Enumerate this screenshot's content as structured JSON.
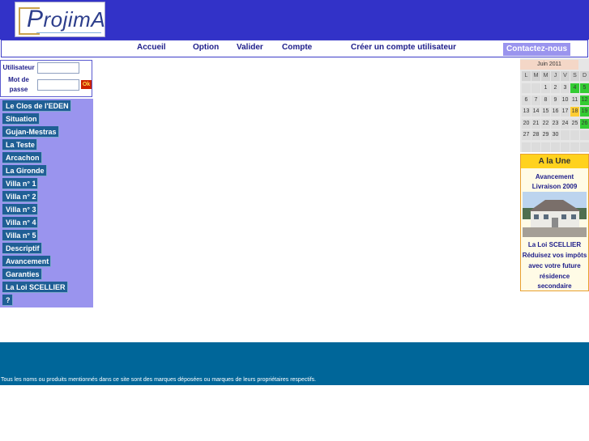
{
  "logo": {
    "wordmark": "rojimA",
    "initial": "P"
  },
  "nav": {
    "items": [
      "Accueil",
      "Option",
      "Valider",
      "Compte",
      "Créer un compte utilisateur"
    ],
    "contact": "Contactez-nous"
  },
  "login": {
    "user_label": "Utilisateur",
    "pass_label_1": "Mot de",
    "pass_label_2": "passe",
    "user_value": "",
    "pass_value": "",
    "ok_label": "Ok"
  },
  "sidemenu": {
    "items": [
      "Le Clos de l'EDEN",
      "Situation",
      "Gujan-Mestras",
      "La Teste",
      "Arcachon",
      "La Gironde",
      "Villa n° 1",
      "Villa n° 2",
      "Villa n° 3",
      "Villa n° 4",
      "Villa n° 5",
      "Descriptif",
      "Avancement",
      "Garanties",
      "La Loi SCELLIER",
      "?"
    ]
  },
  "calendar": {
    "title": "Juin 2011",
    "weekdays": [
      "L",
      "M",
      "M",
      "J",
      "V",
      "S",
      "D"
    ],
    "weeks": [
      [
        "",
        "",
        "1",
        "2",
        "3",
        "4",
        "5"
      ],
      [
        "6",
        "7",
        "8",
        "9",
        "10",
        "11",
        "12"
      ],
      [
        "13",
        "14",
        "15",
        "16",
        "17",
        "18",
        "19"
      ],
      [
        "20",
        "21",
        "22",
        "23",
        "24",
        "25",
        "26"
      ],
      [
        "27",
        "28",
        "29",
        "30",
        "",
        "",
        ""
      ],
      [
        "",
        "",
        "",
        "",
        "",
        "",
        ""
      ]
    ],
    "today": "18",
    "today_color": "#ffcc33",
    "weekend_color": "#33cc33"
  },
  "alaune": {
    "title": "A la Une",
    "line1": "Avancement",
    "line2": "Livraison 2009",
    "line3": "La Loi SCELLIER",
    "line4": "Réduisez vos impôts",
    "line5": "avec votre future",
    "line6": "résidence",
    "line7": "secondaire"
  },
  "footer": {
    "text": "Tous les noms ou produits mentionnés dans ce site sont des marques déposées ou marques de leurs propriétaires respectifs."
  },
  "colors": {
    "header": "#3232c8",
    "menu_panel": "#9a94ee",
    "menu_item": "#1f5f95",
    "footer": "#006699"
  }
}
